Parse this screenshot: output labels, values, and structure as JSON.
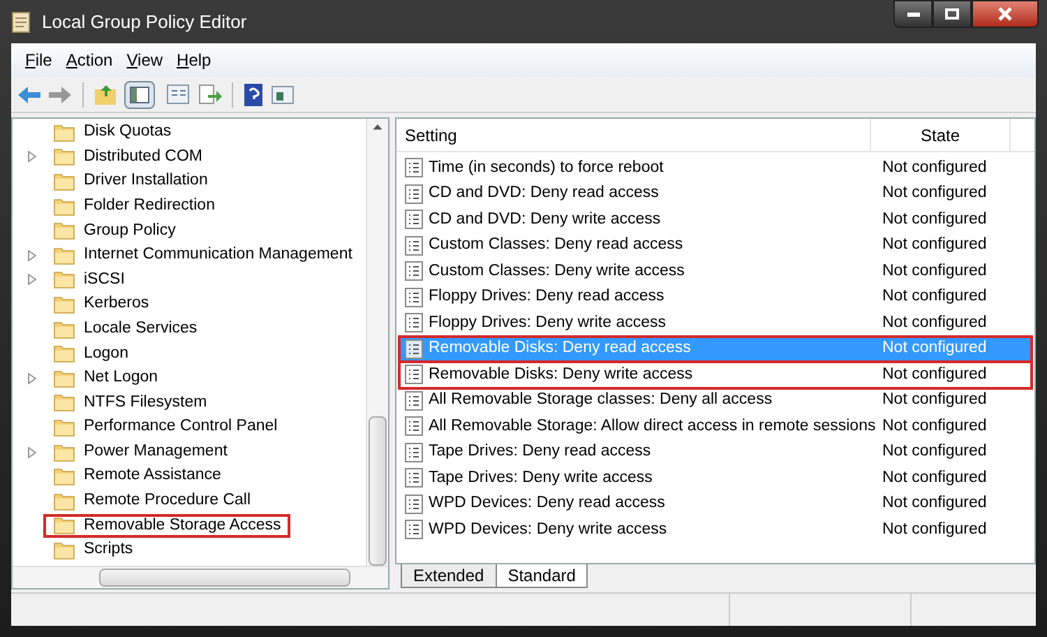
{
  "window": {
    "title": "Local Group Policy Editor"
  },
  "menu": [
    "File",
    "Action",
    "View",
    "Help"
  ],
  "tree": {
    "items": [
      {
        "label": "Disk Quotas",
        "expandable": false,
        "highlighted": false
      },
      {
        "label": "Distributed COM",
        "expandable": true,
        "highlighted": false
      },
      {
        "label": "Driver Installation",
        "expandable": false,
        "highlighted": false
      },
      {
        "label": "Folder Redirection",
        "expandable": false,
        "highlighted": false
      },
      {
        "label": "Group Policy",
        "expandable": false,
        "highlighted": false
      },
      {
        "label": "Internet Communication Management",
        "expandable": true,
        "highlighted": false
      },
      {
        "label": "iSCSI",
        "expandable": true,
        "highlighted": false
      },
      {
        "label": "Kerberos",
        "expandable": false,
        "highlighted": false
      },
      {
        "label": "Locale Services",
        "expandable": false,
        "highlighted": false
      },
      {
        "label": "Logon",
        "expandable": false,
        "highlighted": false
      },
      {
        "label": "Net Logon",
        "expandable": true,
        "highlighted": false
      },
      {
        "label": "NTFS Filesystem",
        "expandable": false,
        "highlighted": false
      },
      {
        "label": "Performance Control Panel",
        "expandable": false,
        "highlighted": false
      },
      {
        "label": "Power Management",
        "expandable": true,
        "highlighted": false
      },
      {
        "label": "Remote Assistance",
        "expandable": false,
        "highlighted": false
      },
      {
        "label": "Remote Procedure Call",
        "expandable": false,
        "highlighted": false
      },
      {
        "label": "Removable Storage Access",
        "expandable": false,
        "highlighted": true
      },
      {
        "label": "Scripts",
        "expandable": false,
        "highlighted": false
      }
    ]
  },
  "table": {
    "columns": [
      "Setting",
      "State"
    ],
    "rows": [
      {
        "setting": "Time (in seconds) to force reboot",
        "state": "Not configured",
        "selected": false,
        "highlighted": false
      },
      {
        "setting": "CD and DVD: Deny read access",
        "state": "Not configured",
        "selected": false,
        "highlighted": false
      },
      {
        "setting": "CD and DVD: Deny write access",
        "state": "Not configured",
        "selected": false,
        "highlighted": false
      },
      {
        "setting": "Custom Classes: Deny read access",
        "state": "Not configured",
        "selected": false,
        "highlighted": false
      },
      {
        "setting": "Custom Classes: Deny write access",
        "state": "Not configured",
        "selected": false,
        "highlighted": false
      },
      {
        "setting": "Floppy Drives: Deny read access",
        "state": "Not configured",
        "selected": false,
        "highlighted": false
      },
      {
        "setting": "Floppy Drives: Deny write access",
        "state": "Not configured",
        "selected": false,
        "highlighted": false
      },
      {
        "setting": "Removable Disks: Deny read access",
        "state": "Not configured",
        "selected": true,
        "highlighted": true
      },
      {
        "setting": "Removable Disks: Deny write access",
        "state": "Not configured",
        "selected": false,
        "highlighted": true
      },
      {
        "setting": "All Removable Storage classes: Deny all access",
        "state": "Not configured",
        "selected": false,
        "highlighted": false
      },
      {
        "setting": "All Removable Storage: Allow direct access in remote sessions",
        "state": "Not configured",
        "selected": false,
        "highlighted": false
      },
      {
        "setting": "Tape Drives: Deny read access",
        "state": "Not configured",
        "selected": false,
        "highlighted": false
      },
      {
        "setting": "Tape Drives: Deny write access",
        "state": "Not configured",
        "selected": false,
        "highlighted": false
      },
      {
        "setting": "WPD Devices: Deny read access",
        "state": "Not configured",
        "selected": false,
        "highlighted": false
      },
      {
        "setting": "WPD Devices: Deny write access",
        "state": "Not configured",
        "selected": false,
        "highlighted": false
      }
    ]
  },
  "tabs": [
    {
      "label": "Extended",
      "selected": false
    },
    {
      "label": "Standard",
      "selected": true
    }
  ]
}
